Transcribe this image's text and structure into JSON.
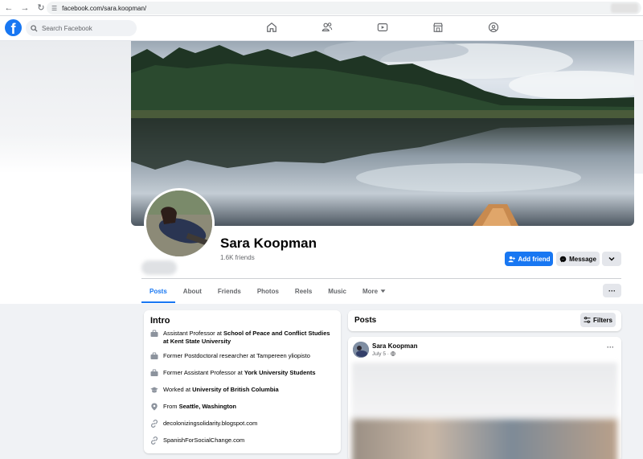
{
  "browser": {
    "url": "facebook.com/sara.koopman/"
  },
  "header": {
    "search_placeholder": "Search Facebook",
    "nav_icons": [
      "home-icon",
      "friends-icon",
      "watch-icon",
      "marketplace-icon",
      "groups-icon"
    ]
  },
  "profile": {
    "name": "Sara Koopman",
    "friends": "1.6K friends",
    "add_friend_label": "Add friend",
    "message_label": "Message"
  },
  "tabs": [
    "Posts",
    "About",
    "Friends",
    "Photos",
    "Reels",
    "Music",
    "More"
  ],
  "intro": {
    "title": "Intro",
    "items": [
      {
        "icon": "briefcase-icon",
        "prefix": "Assistant Professor at ",
        "bold": "School of Peace and Conflict Studies at Kent State University"
      },
      {
        "icon": "briefcase-icon",
        "prefix": "Former Postdoctoral researcher at Tampereen yliopisto",
        "bold": ""
      },
      {
        "icon": "briefcase-icon",
        "prefix": "Former Assistant Professor at ",
        "bold": "York University Students"
      },
      {
        "icon": "graduation-icon",
        "prefix": "Worked at ",
        "bold": "University of British Columbia"
      },
      {
        "icon": "location-pin-icon",
        "prefix": "From ",
        "bold": "Seattle, Washington"
      },
      {
        "icon": "link-icon",
        "prefix": "decolonizingsolidarity.blogspot.com",
        "bold": ""
      },
      {
        "icon": "link-icon",
        "prefix": "SpanishForSocialChange.com",
        "bold": ""
      }
    ]
  },
  "posts": {
    "title": "Posts",
    "filters_label": "Filters",
    "post": {
      "author": "Sara Koopman",
      "date": "July 5 · "
    }
  },
  "colors": {
    "brand": "#1877f2",
    "background": "#f0f2f5"
  }
}
